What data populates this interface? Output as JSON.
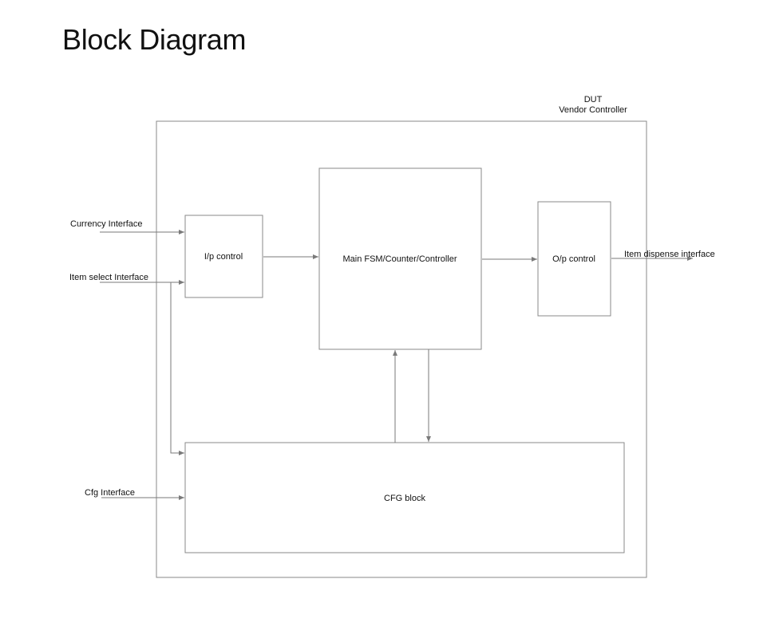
{
  "title": "Block Diagram",
  "dut": {
    "line1": "DUT",
    "line2": "Vendor Controller"
  },
  "blocks": {
    "ip_control": "I/p control",
    "main_fsm": "Main FSM/Counter/Controller",
    "op_control": "O/p control",
    "cfg_block": "CFG block"
  },
  "interfaces": {
    "currency": "Currency Interface",
    "item_select": "Item select Interface",
    "cfg": "Cfg Interface",
    "item_dispense": "Item dispense interface"
  },
  "colors": {
    "line": "#7a7a7a",
    "box_border": "#8a8a8a",
    "text": "#111111"
  }
}
